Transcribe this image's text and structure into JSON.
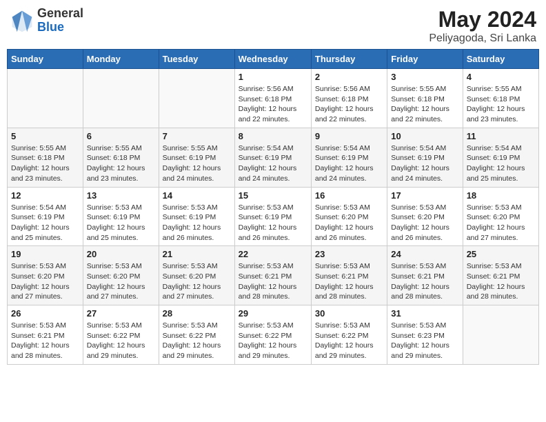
{
  "header": {
    "logo_general": "General",
    "logo_blue": "Blue",
    "month_year": "May 2024",
    "location": "Peliyagoda, Sri Lanka"
  },
  "weekdays": [
    "Sunday",
    "Monday",
    "Tuesday",
    "Wednesday",
    "Thursday",
    "Friday",
    "Saturday"
  ],
  "weeks": [
    [
      {
        "day": "",
        "info": ""
      },
      {
        "day": "",
        "info": ""
      },
      {
        "day": "",
        "info": ""
      },
      {
        "day": "1",
        "info": "Sunrise: 5:56 AM\nSunset: 6:18 PM\nDaylight: 12 hours\nand 22 minutes."
      },
      {
        "day": "2",
        "info": "Sunrise: 5:56 AM\nSunset: 6:18 PM\nDaylight: 12 hours\nand 22 minutes."
      },
      {
        "day": "3",
        "info": "Sunrise: 5:55 AM\nSunset: 6:18 PM\nDaylight: 12 hours\nand 22 minutes."
      },
      {
        "day": "4",
        "info": "Sunrise: 5:55 AM\nSunset: 6:18 PM\nDaylight: 12 hours\nand 23 minutes."
      }
    ],
    [
      {
        "day": "5",
        "info": "Sunrise: 5:55 AM\nSunset: 6:18 PM\nDaylight: 12 hours\nand 23 minutes."
      },
      {
        "day": "6",
        "info": "Sunrise: 5:55 AM\nSunset: 6:18 PM\nDaylight: 12 hours\nand 23 minutes."
      },
      {
        "day": "7",
        "info": "Sunrise: 5:55 AM\nSunset: 6:19 PM\nDaylight: 12 hours\nand 24 minutes."
      },
      {
        "day": "8",
        "info": "Sunrise: 5:54 AM\nSunset: 6:19 PM\nDaylight: 12 hours\nand 24 minutes."
      },
      {
        "day": "9",
        "info": "Sunrise: 5:54 AM\nSunset: 6:19 PM\nDaylight: 12 hours\nand 24 minutes."
      },
      {
        "day": "10",
        "info": "Sunrise: 5:54 AM\nSunset: 6:19 PM\nDaylight: 12 hours\nand 24 minutes."
      },
      {
        "day": "11",
        "info": "Sunrise: 5:54 AM\nSunset: 6:19 PM\nDaylight: 12 hours\nand 25 minutes."
      }
    ],
    [
      {
        "day": "12",
        "info": "Sunrise: 5:54 AM\nSunset: 6:19 PM\nDaylight: 12 hours\nand 25 minutes."
      },
      {
        "day": "13",
        "info": "Sunrise: 5:53 AM\nSunset: 6:19 PM\nDaylight: 12 hours\nand 25 minutes."
      },
      {
        "day": "14",
        "info": "Sunrise: 5:53 AM\nSunset: 6:19 PM\nDaylight: 12 hours\nand 26 minutes."
      },
      {
        "day": "15",
        "info": "Sunrise: 5:53 AM\nSunset: 6:19 PM\nDaylight: 12 hours\nand 26 minutes."
      },
      {
        "day": "16",
        "info": "Sunrise: 5:53 AM\nSunset: 6:20 PM\nDaylight: 12 hours\nand 26 minutes."
      },
      {
        "day": "17",
        "info": "Sunrise: 5:53 AM\nSunset: 6:20 PM\nDaylight: 12 hours\nand 26 minutes."
      },
      {
        "day": "18",
        "info": "Sunrise: 5:53 AM\nSunset: 6:20 PM\nDaylight: 12 hours\nand 27 minutes."
      }
    ],
    [
      {
        "day": "19",
        "info": "Sunrise: 5:53 AM\nSunset: 6:20 PM\nDaylight: 12 hours\nand 27 minutes."
      },
      {
        "day": "20",
        "info": "Sunrise: 5:53 AM\nSunset: 6:20 PM\nDaylight: 12 hours\nand 27 minutes."
      },
      {
        "day": "21",
        "info": "Sunrise: 5:53 AM\nSunset: 6:20 PM\nDaylight: 12 hours\nand 27 minutes."
      },
      {
        "day": "22",
        "info": "Sunrise: 5:53 AM\nSunset: 6:21 PM\nDaylight: 12 hours\nand 28 minutes."
      },
      {
        "day": "23",
        "info": "Sunrise: 5:53 AM\nSunset: 6:21 PM\nDaylight: 12 hours\nand 28 minutes."
      },
      {
        "day": "24",
        "info": "Sunrise: 5:53 AM\nSunset: 6:21 PM\nDaylight: 12 hours\nand 28 minutes."
      },
      {
        "day": "25",
        "info": "Sunrise: 5:53 AM\nSunset: 6:21 PM\nDaylight: 12 hours\nand 28 minutes."
      }
    ],
    [
      {
        "day": "26",
        "info": "Sunrise: 5:53 AM\nSunset: 6:21 PM\nDaylight: 12 hours\nand 28 minutes."
      },
      {
        "day": "27",
        "info": "Sunrise: 5:53 AM\nSunset: 6:22 PM\nDaylight: 12 hours\nand 29 minutes."
      },
      {
        "day": "28",
        "info": "Sunrise: 5:53 AM\nSunset: 6:22 PM\nDaylight: 12 hours\nand 29 minutes."
      },
      {
        "day": "29",
        "info": "Sunrise: 5:53 AM\nSunset: 6:22 PM\nDaylight: 12 hours\nand 29 minutes."
      },
      {
        "day": "30",
        "info": "Sunrise: 5:53 AM\nSunset: 6:22 PM\nDaylight: 12 hours\nand 29 minutes."
      },
      {
        "day": "31",
        "info": "Sunrise: 5:53 AM\nSunset: 6:23 PM\nDaylight: 12 hours\nand 29 minutes."
      },
      {
        "day": "",
        "info": ""
      }
    ]
  ]
}
